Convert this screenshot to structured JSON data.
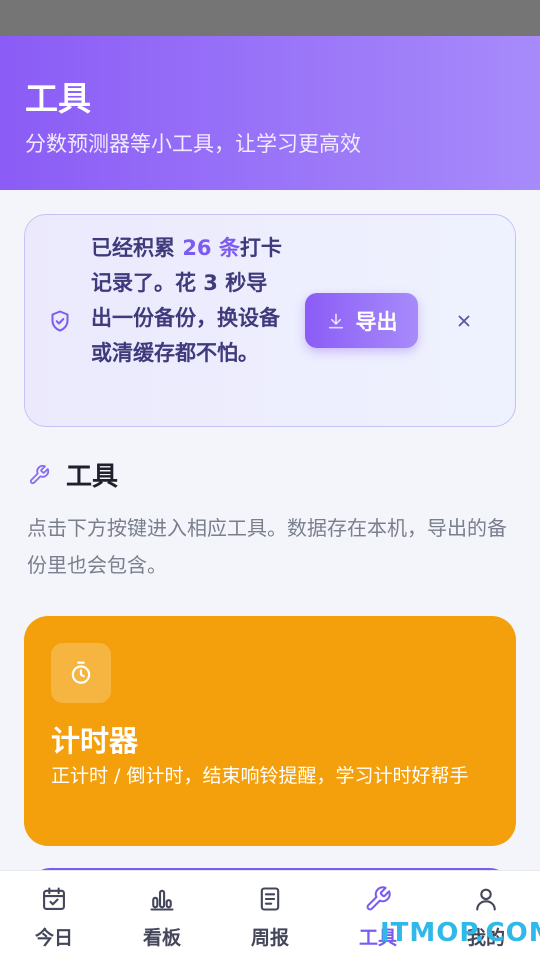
{
  "header": {
    "title": "工具",
    "subtitle": "分数预测器等小工具，让学习更高效"
  },
  "notice": {
    "msg_pre": "已经积累 ",
    "msg_count": "26 条",
    "msg_post": "打卡记录了。花 3 秒导出一份备份，换设备或清缓存都不怕。",
    "export_label": "导出",
    "icon": "shield-check-icon",
    "close_icon": "close-icon"
  },
  "section": {
    "title": "工具",
    "desc": "点击下方按键进入相应工具。数据存在本机，导出的备份里也会包含。",
    "icon": "wrench-icon"
  },
  "tools": [
    {
      "title": "计时器",
      "desc": "正计时 / 倒计时，结束响铃提醒，学习计时好帮手",
      "icon": "stopwatch-icon",
      "color": "#f4a00c"
    }
  ],
  "tabbar": {
    "items": [
      {
        "label": "今日",
        "icon": "calendar-check-icon"
      },
      {
        "label": "看板",
        "icon": "bar-chart-icon"
      },
      {
        "label": "周报",
        "icon": "document-icon"
      },
      {
        "label": "工具",
        "icon": "wrench-icon",
        "active": true
      },
      {
        "label": "我的",
        "icon": "user-icon"
      }
    ]
  },
  "watermark": "ITMOP.COM",
  "colors": {
    "accent": "#8b5cf6",
    "tool_orange": "#f4a00c",
    "status_bar": "#757575"
  }
}
